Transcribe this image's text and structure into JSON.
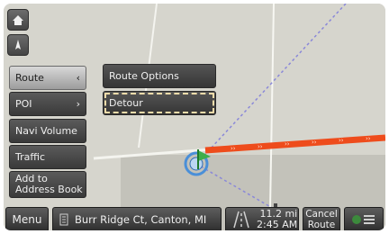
{
  "colors": {
    "route": "#ee4c1c",
    "map_bg": "#d6d5cd",
    "focus_outline": "#f0dcaa"
  },
  "map_controls": {
    "home_icon": "home-icon",
    "compass_icon": "compass-icon"
  },
  "menu": {
    "items": [
      {
        "label": "Route",
        "has_submenu": true,
        "active": true
      },
      {
        "label": "POI",
        "has_submenu": true,
        "active": false
      },
      {
        "label": "Navi Volume",
        "has_submenu": false,
        "active": false
      },
      {
        "label": "Traffic",
        "has_submenu": false,
        "active": false
      },
      {
        "label_line1": "Add to",
        "label_line2": "Address Book",
        "has_submenu": false,
        "active": false
      }
    ],
    "submenu": [
      {
        "label": "Route Options",
        "focused": false
      },
      {
        "label": "Detour",
        "focused": true
      }
    ]
  },
  "bottom_bar": {
    "menu_label": "Menu",
    "destination": "Burr Ridge Ct, Canton, MI",
    "distance": "11.2 mi",
    "eta": "2:45 AM",
    "cancel_line1": "Cancel",
    "cancel_line2": "Route",
    "list_icon": "list-icon"
  }
}
